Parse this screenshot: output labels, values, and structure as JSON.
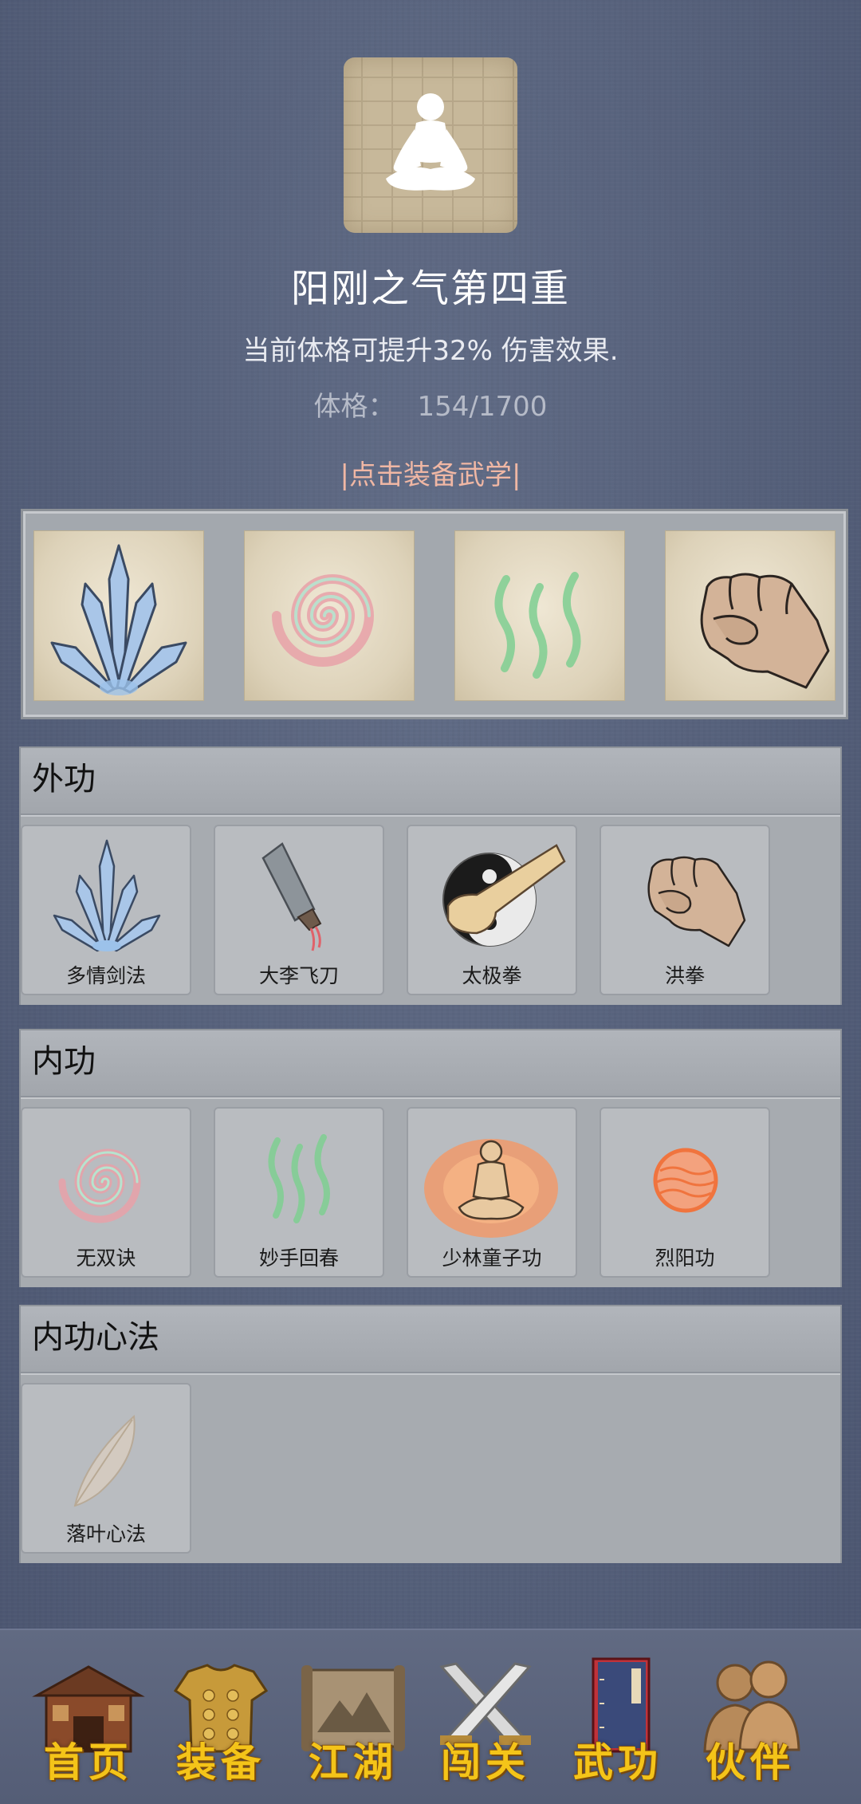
{
  "header": {
    "title": "阳刚之气第四重",
    "description": "当前体格可提升32% 伤害效果.",
    "stat_label": "体格：",
    "stat_value": "154/1700",
    "equip_link": "|点击装备武学|"
  },
  "equipped": [
    {
      "icon": "sword-fan-icon"
    },
    {
      "icon": "spiral-icon"
    },
    {
      "icon": "green-waves-icon"
    },
    {
      "icon": "fist-icon"
    }
  ],
  "sections": [
    {
      "title": "外功",
      "items": [
        {
          "label": "多情剑法",
          "icon": "sword-fan-icon"
        },
        {
          "label": "大李飞刀",
          "icon": "cleaver-icon"
        },
        {
          "label": "太极拳",
          "icon": "taiji-icon"
        },
        {
          "label": "洪拳",
          "icon": "fist-icon"
        }
      ]
    },
    {
      "title": "内功",
      "items": [
        {
          "label": "无双诀",
          "icon": "spiral-icon"
        },
        {
          "label": "妙手回春",
          "icon": "green-waves-icon"
        },
        {
          "label": "少林童子功",
          "icon": "meditating-monk-icon"
        },
        {
          "label": "烈阳功",
          "icon": "fire-orb-icon"
        }
      ]
    },
    {
      "title": "内功心法",
      "items": [
        {
          "label": "落叶心法",
          "icon": "leaf-icon"
        }
      ]
    }
  ],
  "nav": [
    {
      "label": "首页",
      "icon": "house-icon"
    },
    {
      "label": "装备",
      "icon": "armor-icon"
    },
    {
      "label": "江湖",
      "icon": "scroll-map-icon"
    },
    {
      "label": "闯关",
      "icon": "crossed-swords-icon"
    },
    {
      "label": "武功",
      "icon": "book-icon"
    },
    {
      "label": "伙伴",
      "icon": "companions-icon"
    }
  ],
  "colors": {
    "background": "#58627c",
    "link": "#f0b7a4",
    "nav_label": "#f4c419"
  }
}
